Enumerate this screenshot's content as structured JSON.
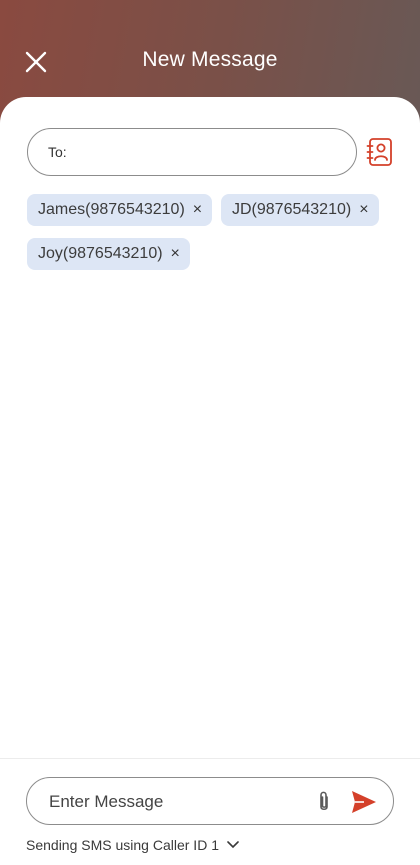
{
  "header": {
    "title": "New Message",
    "close_icon": "close-icon"
  },
  "to_field": {
    "label": "To:",
    "value": "",
    "contacts_icon": "contact-book-icon"
  },
  "recipients": [
    {
      "label": "James(9876543210)",
      "remove": "×"
    },
    {
      "label": "JD(9876543210)",
      "remove": "×"
    },
    {
      "label": "Joy(9876543210)",
      "remove": "×"
    }
  ],
  "composer": {
    "placeholder": "Enter Message",
    "attach_icon": "paperclip-icon",
    "send_icon": "send-icon"
  },
  "footer": {
    "sending_text": "Sending SMS using Caller ID 1",
    "dropdown_icon": "chevron-down-icon"
  },
  "colors": {
    "accent": "#d4402a",
    "chip_bg": "#dde6f5"
  }
}
